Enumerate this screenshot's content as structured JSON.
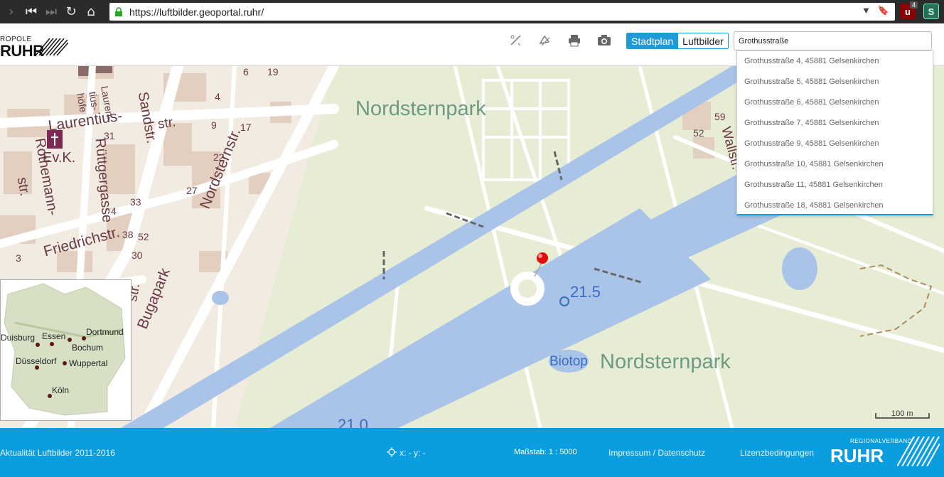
{
  "browser": {
    "url": "https://luftbilder.geoportal.ruhr/",
    "extension_badge": "4",
    "extension_s_label": "S"
  },
  "header": {
    "logo_small": "ROPOLE",
    "logo_big": "RUHR",
    "view_toggle": {
      "stadtplan": "Stadtplan",
      "luftbilder": "Luftbilder",
      "selected": "Stadtplan"
    },
    "tools": [
      "measure-line-icon",
      "measure-area-icon",
      "print-icon",
      "camera-icon"
    ]
  },
  "search": {
    "value": "Grothusstraße",
    "suggestions": [
      "Grothusstraße 4, 45881 Gelsenkirchen",
      "Grothusstraße 5, 45881 Gelsenkirchen",
      "Grothusstraße 6, 45881 Gelsenkirchen",
      "Grothusstraße 7, 45881 Gelsenkirchen",
      "Grothusstraße 9, 45881 Gelsenkirchen",
      "Grothusstraße 10, 45881 Gelsenkirchen",
      "Grothusstraße 11, 45881 Gelsenkirchen",
      "Grothusstraße 18, 45881 Gelsenkirchen"
    ]
  },
  "map": {
    "labels": {
      "park_top": "Nordsternpark",
      "park_bottom": "Nordsternpark",
      "biotop": "Biotop",
      "elev_1": "21.5",
      "elev_2": "21.0",
      "laurentius": "Laurentius-",
      "str1": "str.",
      "laurentius_hoefe_1": "Lauren-",
      "laurentius_hoefe_2": "tius-",
      "laurentius_hoefe_3": "höfe",
      "sandstr": "Sandstr.",
      "nordsternstr": "Nordsternstr.",
      "rothemann": "Rothemann-",
      "str2": "str.",
      "ruettgergasse": "Rüttgergasse",
      "friedrichstr": "Friedrichstr.",
      "bugapark": "Bugapark",
      "str3": "str.",
      "wallstr": "Wallstr.",
      "church": "Ev.K.",
      "num_4": "4",
      "num_9": "9",
      "num_17": "17",
      "num_31": "31",
      "num_22": "22",
      "num_27": "27",
      "num_33": "33",
      "num_4b": "4",
      "num_38": "38",
      "num_52": "52",
      "num_30": "30",
      "num_3": "3",
      "num_59": "59",
      "num_52b": "52",
      "num_6": "6",
      "num_19": "19"
    },
    "scale_label": "100 m",
    "overview_cities": [
      "Duisburg",
      "Essen",
      "Dortmund",
      "Bochum",
      "Düsseldorf",
      "Wuppertal",
      "Köln"
    ],
    "marker_color": "#e01010",
    "water_color": "#a9c4e8",
    "park_color": "#e4ecd2"
  },
  "footer": {
    "aktualitaet": "Aktualität Luftbilder 2011-2016",
    "coords": "x: - y: -",
    "massstab": "Maßstab: 1 : 5000",
    "impressum": "Impressum / Datenschutz",
    "lizenz": "Lizenzbedingungen",
    "logo_small": "REGIONALVERBAND",
    "logo_big": "RUHR"
  }
}
